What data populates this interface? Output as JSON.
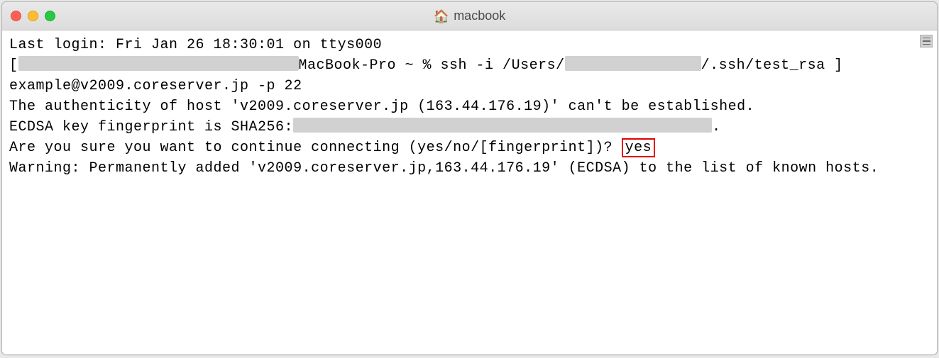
{
  "window": {
    "title": "macbook"
  },
  "terminal": {
    "line1": "Last login: Fri Jan 26 18:30:01 on ttys000",
    "line2_open": "[",
    "line2_mid": "MacBook-Pro ~ % ssh -i /Users/",
    "line2_end": "/.ssh/test_rsa ]",
    "line3": "example@v2009.coreserver.jp -p 22",
    "line4": "The authenticity of host 'v2009.coreserver.jp (163.44.176.19)' can't be established.",
    "line5_pre": "ECDSA key fingerprint is SHA256:",
    "line5_post": ".",
    "line6_prompt": "Are you sure you want to continue connecting (yes/no/[fingerprint])? ",
    "line6_answer": "yes",
    "line7": "Warning: Permanently added 'v2009.coreserver.jp,163.44.176.19' (ECDSA) to the list of known hosts."
  }
}
